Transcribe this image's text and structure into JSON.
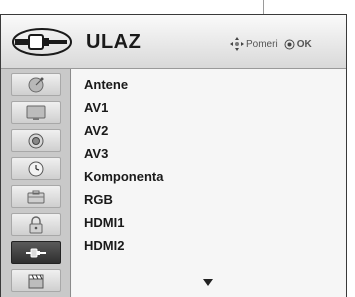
{
  "menu": {
    "title": "ULAZ",
    "title_icon": "input-plug-icon",
    "hint_move_label": "Pomeri",
    "hint_ok_label": "OK"
  },
  "sidebar": {
    "items": [
      {
        "icon": "satellite-dish-icon",
        "active": false
      },
      {
        "icon": "tv-screen-icon",
        "active": false
      },
      {
        "icon": "speaker-icon",
        "active": false
      },
      {
        "icon": "clock-icon",
        "active": false
      },
      {
        "icon": "toolbox-icon",
        "active": false
      },
      {
        "icon": "lock-icon",
        "active": false
      },
      {
        "icon": "input-plug-icon",
        "active": true
      },
      {
        "icon": "film-clapper-icon",
        "active": false
      }
    ]
  },
  "list": {
    "items": [
      "Antene",
      "AV1",
      "AV2",
      "AV3",
      "Komponenta",
      "RGB",
      "HDMI1",
      "HDMI2"
    ],
    "more_indicator": "down-arrow-icon"
  },
  "colors": {
    "active_tile": "#3a3a3a",
    "panel_border": "#3a3a3a",
    "text": "#1a1a1a"
  }
}
